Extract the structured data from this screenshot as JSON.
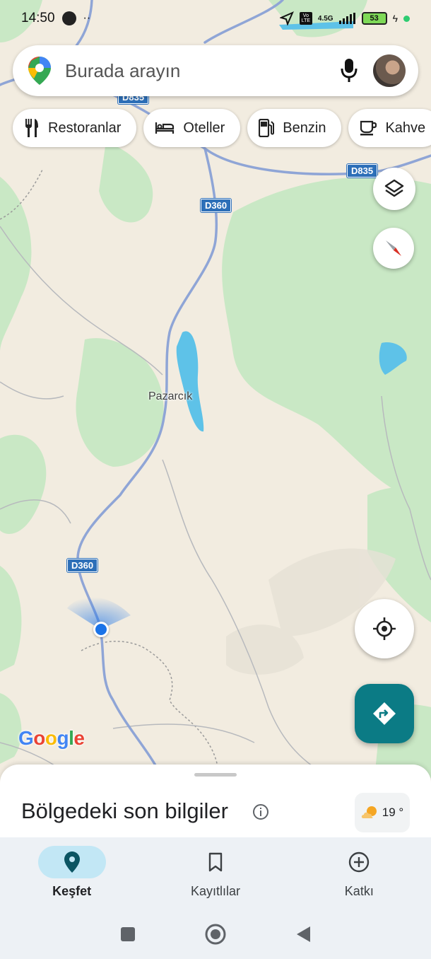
{
  "status_bar": {
    "time": "14:50",
    "network": "4.5G",
    "volte": "Vo LTE",
    "battery": "53"
  },
  "search": {
    "placeholder": "Burada arayın"
  },
  "chips": [
    {
      "label": "Restoranlar",
      "icon": "restaurant-icon"
    },
    {
      "label": "Oteller",
      "icon": "hotel-icon"
    },
    {
      "label": "Benzin",
      "icon": "gas-station-icon"
    },
    {
      "label": "Kahve",
      "icon": "coffee-icon"
    }
  ],
  "map": {
    "road_labels": [
      "D835",
      "D360",
      "D835",
      "D360"
    ],
    "place_label": "Pazarcık",
    "logo": "Google"
  },
  "sheet": {
    "title": "Bölgedeki son bilgiler",
    "weather_temp": "19 °"
  },
  "nav": {
    "items": [
      {
        "label": "Keşfet",
        "icon": "explore-pin-icon",
        "active": true
      },
      {
        "label": "Kayıtlılar",
        "icon": "bookmark-icon",
        "active": false
      },
      {
        "label": "Katkı",
        "icon": "add-circle-icon",
        "active": false
      }
    ]
  },
  "colors": {
    "map_background": "#f2ece0",
    "forest": "#c9e8c5",
    "water": "#5ec2e8",
    "road": "#8fa5d6",
    "location_dot": "#1a73e8",
    "directions_button": "#0b7b85",
    "nav_active_pill": "#c2e7f5"
  }
}
